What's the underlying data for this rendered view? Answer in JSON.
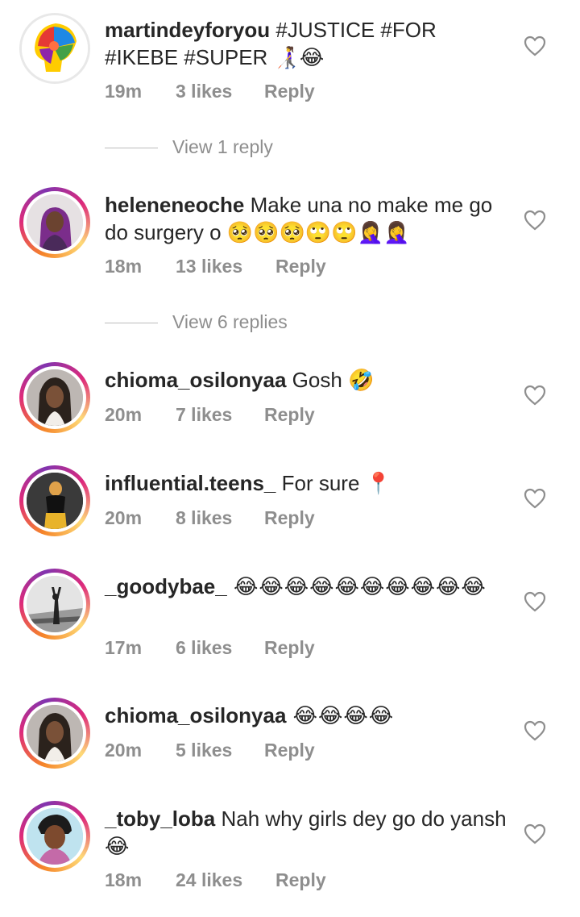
{
  "comments": [
    {
      "username": "martindeyforyou",
      "text": " #JUSTICE #FOR #IKEBE #SUPER 👩‍🦯😂",
      "time": "19m",
      "likes": "3 likes",
      "reply": "Reply"
    },
    {
      "username": "heleneneoche",
      "text": " Make una no make me go do surgery o 🥺🥺🥺🙄🙄🤦‍♀️🤦‍♀️",
      "time": "18m",
      "likes": "13 likes",
      "reply": "Reply"
    },
    {
      "username": "chioma_osilonyaa",
      "text": " Gosh 🤣",
      "time": "20m",
      "likes": "7 likes",
      "reply": "Reply"
    },
    {
      "username": "influential.teens_",
      "text": " For sure 📍",
      "time": "20m",
      "likes": "8 likes",
      "reply": "Reply"
    },
    {
      "username": "_goodybae_",
      "text": " 😂😂😂😂😂😂😂😂😂😂",
      "time": "17m",
      "likes": "6 likes",
      "reply": "Reply"
    },
    {
      "username": "chioma_osilonyaa",
      "text": " 😂😂😂😂",
      "time": "20m",
      "likes": "5 likes",
      "reply": "Reply"
    },
    {
      "username": "_toby_loba",
      "text": " Nah why girls dey go do yansh 😂",
      "time": "18m",
      "likes": "24 likes",
      "reply": "Reply"
    }
  ],
  "view_replies": [
    "View 1 reply",
    "View 6 replies"
  ],
  "icons": {
    "like": "heart-outline-icon"
  },
  "colors": {
    "text": "#262626",
    "meta": "#8e8e8e",
    "ring_start": "#f58529",
    "ring_mid": "#dd2a7b",
    "ring_end": "#8134af"
  }
}
